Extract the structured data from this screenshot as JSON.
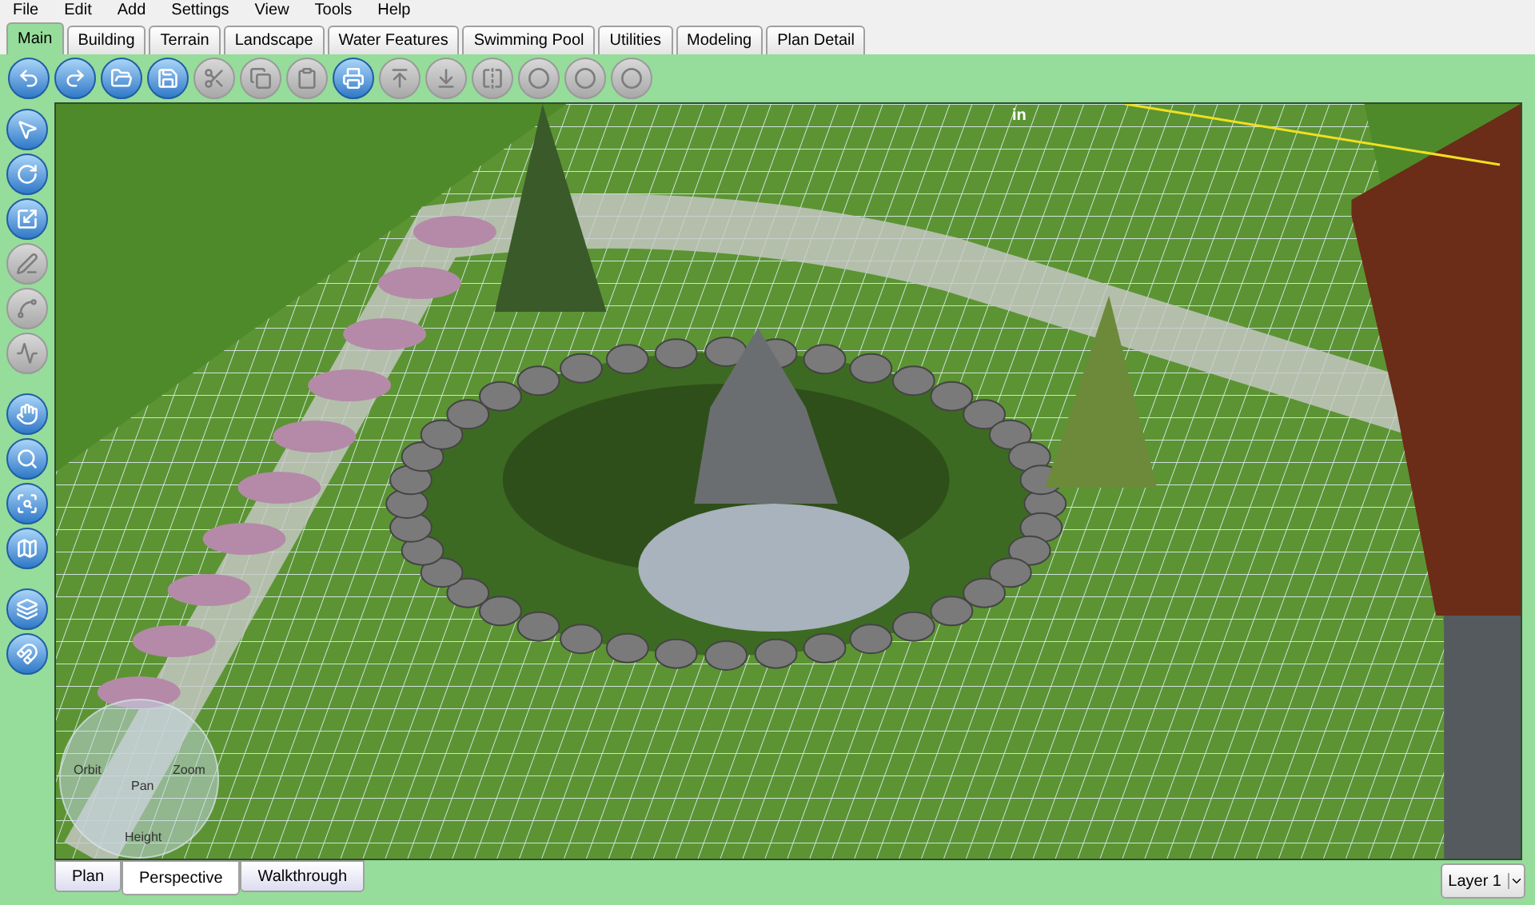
{
  "menu": [
    "File",
    "Edit",
    "Add",
    "Settings",
    "View",
    "Tools",
    "Help"
  ],
  "tabs": [
    {
      "label": "Main",
      "selected": true
    },
    {
      "label": "Building",
      "selected": false
    },
    {
      "label": "Terrain",
      "selected": false
    },
    {
      "label": "Landscape",
      "selected": false
    },
    {
      "label": "Water Features",
      "selected": false
    },
    {
      "label": "Swimming Pool",
      "selected": false
    },
    {
      "label": "Utilities",
      "selected": false
    },
    {
      "label": "Modeling",
      "selected": false
    },
    {
      "label": "Plan Detail",
      "selected": false
    }
  ],
  "toolbar": [
    {
      "kind": "undo",
      "disabled": false
    },
    {
      "kind": "redo",
      "disabled": false
    },
    {
      "kind": "open",
      "disabled": false
    },
    {
      "kind": "save",
      "disabled": false
    },
    {
      "kind": "cut",
      "disabled": true
    },
    {
      "kind": "copy",
      "disabled": true
    },
    {
      "kind": "paste",
      "disabled": true
    },
    {
      "kind": "print",
      "disabled": false
    },
    {
      "kind": "raise",
      "disabled": true
    },
    {
      "kind": "lower",
      "disabled": true
    },
    {
      "kind": "mirror",
      "disabled": true
    },
    {
      "kind": "merge",
      "disabled": true
    },
    {
      "kind": "subtract",
      "disabled": true
    },
    {
      "kind": "intersect",
      "disabled": true
    }
  ],
  "side_tool_groups": [
    [
      {
        "kind": "select",
        "disabled": false
      },
      {
        "kind": "rotate",
        "disabled": false
      },
      {
        "kind": "resize",
        "disabled": false
      },
      {
        "kind": "freehand",
        "disabled": true
      },
      {
        "kind": "arc",
        "disabled": true
      },
      {
        "kind": "polyline",
        "disabled": true
      }
    ],
    [
      {
        "kind": "pan",
        "disabled": false
      },
      {
        "kind": "zoom",
        "disabled": false
      },
      {
        "kind": "zoom-fit",
        "disabled": false
      },
      {
        "kind": "map",
        "disabled": false
      }
    ],
    [
      {
        "kind": "terrain",
        "disabled": false
      },
      {
        "kind": "magnet",
        "disabled": false
      }
    ]
  ],
  "viewport": {
    "measurement": "in",
    "navigator": {
      "orbit": "Orbit",
      "pan": "Pan",
      "zoom": "Zoom",
      "height": "Height"
    }
  },
  "view_tabs": [
    {
      "label": "Plan",
      "selected": false
    },
    {
      "label": "Perspective",
      "selected": true
    },
    {
      "label": "Walkthrough",
      "selected": false
    }
  ],
  "layer_select": {
    "value": "Layer 1"
  }
}
